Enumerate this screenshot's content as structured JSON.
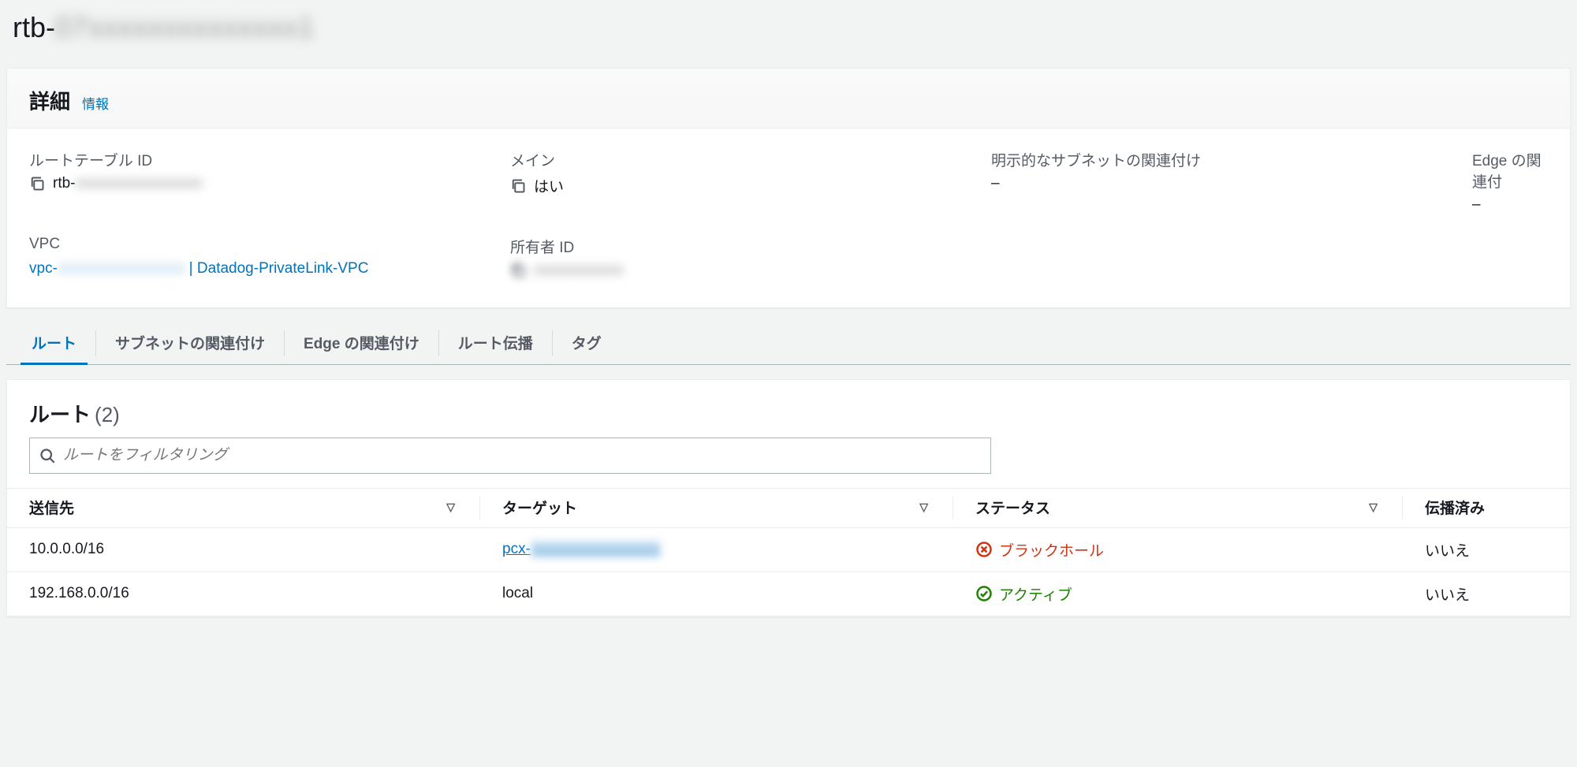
{
  "header": {
    "title_prefix": "rtb-",
    "title_obscured": "07xxxxxxxxxxxxxx1"
  },
  "details": {
    "title": "詳細",
    "info_label": "情報",
    "fields": {
      "route_table_id": {
        "label": "ルートテーブル ID",
        "value_prefix": "rtb-",
        "value_obscured": "xxxxxxxxxxxxxxxxx"
      },
      "main": {
        "label": "メイン",
        "value": "はい"
      },
      "explicit_subnet": {
        "label": "明示的なサブネットの関連付け",
        "value": "–"
      },
      "edge_assoc": {
        "label": "Edge の関連付",
        "value": "–"
      },
      "vpc": {
        "label": "VPC",
        "prefix": "vpc-",
        "obscured": "xxxxxxxxxxxxxxxxx",
        "separator": " | ",
        "suffix": "Datadog-PrivateLink-VPC"
      },
      "owner_id": {
        "label": "所有者 ID",
        "value_obscured": "xxxxxxxxxxxx"
      }
    }
  },
  "tabs": [
    {
      "id": "routes",
      "label": "ルート",
      "active": true
    },
    {
      "id": "subnet-assoc",
      "label": "サブネットの関連付け",
      "active": false
    },
    {
      "id": "edge-assoc",
      "label": "Edge の関連付け",
      "active": false
    },
    {
      "id": "route-prop",
      "label": "ルート伝播",
      "active": false
    },
    {
      "id": "tags",
      "label": "タグ",
      "active": false
    }
  ],
  "routes": {
    "title": "ルート",
    "count_display": "(2)",
    "filter_placeholder": "ルートをフィルタリング",
    "columns": {
      "destination": "送信先",
      "target": "ターゲット",
      "status": "ステータス",
      "propagated": "伝播済み"
    },
    "status_labels": {
      "blackhole": "ブラックホール",
      "active": "アクティブ"
    },
    "rows": [
      {
        "destination": "10.0.0.0/16",
        "target_prefix": "pcx-",
        "target_obscured": "xxxxxxxxxxxxxxxxx",
        "target_is_link": true,
        "status": "blackhole",
        "propagated": "いいえ"
      },
      {
        "destination": "192.168.0.0/16",
        "target": "local",
        "target_is_link": false,
        "status": "active",
        "propagated": "いいえ"
      }
    ]
  }
}
